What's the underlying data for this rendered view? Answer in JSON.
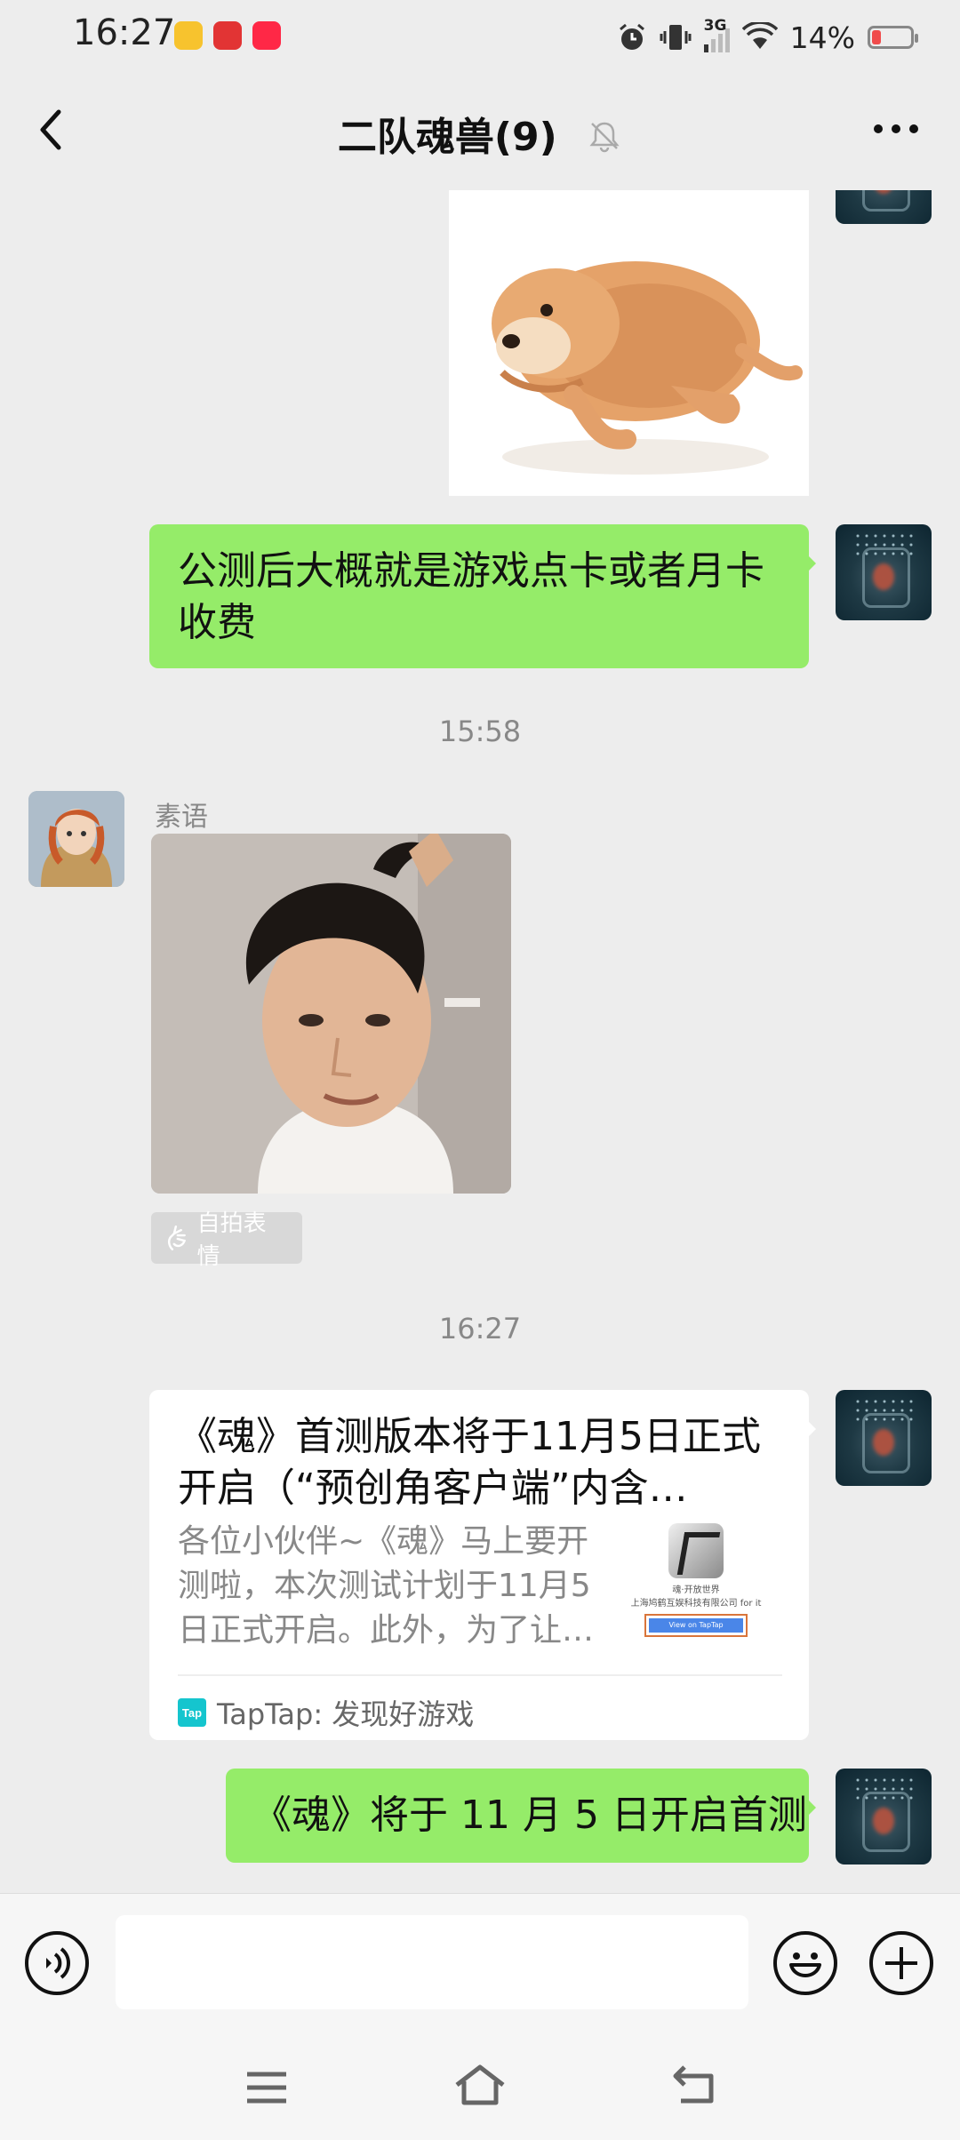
{
  "status": {
    "time": "16:27",
    "network": "3G",
    "battery_text": "14%",
    "battery_level": 0.14
  },
  "header": {
    "title": "二队魂兽(9)"
  },
  "messages": {
    "m1_text": "公测后大概就是游戏点卡或者月卡收费",
    "ts1": "15:58",
    "sender_name": "素语",
    "selfie_tag": "自拍表情",
    "ts2": "16:27",
    "card": {
      "title": "《魂》首测版本将于11月5日正式开启（“预创角客户端”内含…",
      "desc": "各位小伙伴~《魂》马上要开测啦，本次测试计划于11月5日正式开启。此外，为了让…",
      "thumb_line1": "魂·开放世界",
      "thumb_line2": "上海鸠鹤互娱科技有限公司 for it",
      "thumb_button": "View on TapTap",
      "logo_text": "Tap",
      "source": "TapTap: 发现好游戏"
    },
    "m2_text": "《魂》将于 11 月 5 日开启首测"
  },
  "icons": {
    "back": "chevron-left-icon",
    "mute": "bell-off-icon",
    "more": "more-dots-icon",
    "voice": "voice-icon",
    "emoji": "emoji-icon",
    "plus": "plus-icon"
  },
  "colors": {
    "bubble_green": "#95ec69",
    "background": "#ededed",
    "battery_low": "#f04b4b"
  }
}
